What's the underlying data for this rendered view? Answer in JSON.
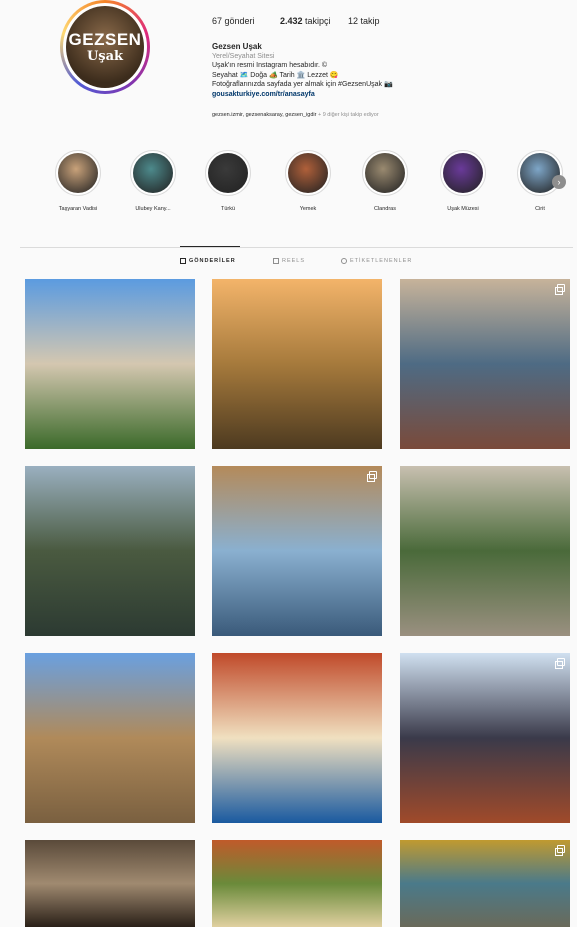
{
  "profile": {
    "avatar_line1": "GEZSEN",
    "avatar_line2": "Uşak",
    "posts": "67 gönderi",
    "followers_count": "2.432",
    "followers_label": " takipçi",
    "following": "12 takip",
    "name": "Gezsen Uşak",
    "category": "Yerel/Seyahat Sitesi",
    "bio_line1": "Uşak'ın resmi Instagram hesabıdır. ©",
    "bio_line2": "Seyahat 🗺️ Doğa 🏕️ Tarih 🏛️ Lezzet 😋",
    "bio_line3": "Fotoğraflarınızda sayfada yer almak için #GezsenUşak 📷",
    "link": "gousakturkiye.com/tr/anasayfa",
    "followed_by": "gezsen.izmir, gezsenaksaray, gezsen_igdir",
    "followed_more": " + 9 diğer kişi takip ediyor"
  },
  "highlights": [
    {
      "label": "Taşyaran Vadisi",
      "color": "#c9a27a"
    },
    {
      "label": "Ulubey Kany...",
      "color": "#4d8a8c"
    },
    {
      "label": "Türkü",
      "color": "#3a3a3a"
    },
    {
      "label": "Yemek",
      "color": "#b0603a"
    },
    {
      "label": "Clandras",
      "color": "#9a8a70"
    },
    {
      "label": "Uşak Müzesi",
      "color": "#6a3a9a"
    },
    {
      "label": "Cirit",
      "color": "#7ea6c8"
    }
  ],
  "tabs": {
    "posts": "GÖNDERİLER",
    "reels": "REELS",
    "tagged": "ETİKETLENENLER"
  },
  "posts": [
    {
      "desc": "rock formations valley",
      "colors": [
        "#5b9be0",
        "#d4c7b0",
        "#3b6a2a"
      ],
      "multi": false
    },
    {
      "desc": "column at sunset",
      "colors": [
        "#f3b46a",
        "#a67a3c",
        "#4d3a20"
      ],
      "multi": false
    },
    {
      "desc": "canyon landscape",
      "colors": [
        "#c7b39a",
        "#4e6b84",
        "#7a4a3a"
      ],
      "multi": true
    },
    {
      "desc": "river and trees",
      "colors": [
        "#9ab0c0",
        "#4a5a40",
        "#2c3a32"
      ],
      "multi": false
    },
    {
      "desc": "waterfall bridge",
      "colors": [
        "#b48a5a",
        "#8ab0d0",
        "#3a5a7a"
      ],
      "multi": true
    },
    {
      "desc": "aerial forest",
      "colors": [
        "#c8c0b0",
        "#4a6a3a",
        "#9a9080"
      ],
      "multi": false
    },
    {
      "desc": "ancient ruins",
      "colors": [
        "#6aa0e0",
        "#b08a5a",
        "#7a6040"
      ],
      "multi": false
    },
    {
      "desc": "food plate",
      "colors": [
        "#c04a2a",
        "#f0e0c0",
        "#1a5aa0"
      ],
      "multi": false
    },
    {
      "desc": "folk dancers",
      "colors": [
        "#d0e0f0",
        "#3a3a4a",
        "#a04a2a"
      ],
      "multi": true
    },
    {
      "desc": "museum artifact",
      "colors": [
        "#5a4a3a",
        "#a08a70",
        "#2a2018"
      ],
      "multi": false
    },
    {
      "desc": "meze table",
      "colors": [
        "#c05a2a",
        "#6a8a3a",
        "#e0d0a0"
      ],
      "multi": false
    },
    {
      "desc": "aerial dam",
      "colors": [
        "#c09a30",
        "#4a7a8a",
        "#6a6a5a"
      ],
      "multi": true
    }
  ]
}
